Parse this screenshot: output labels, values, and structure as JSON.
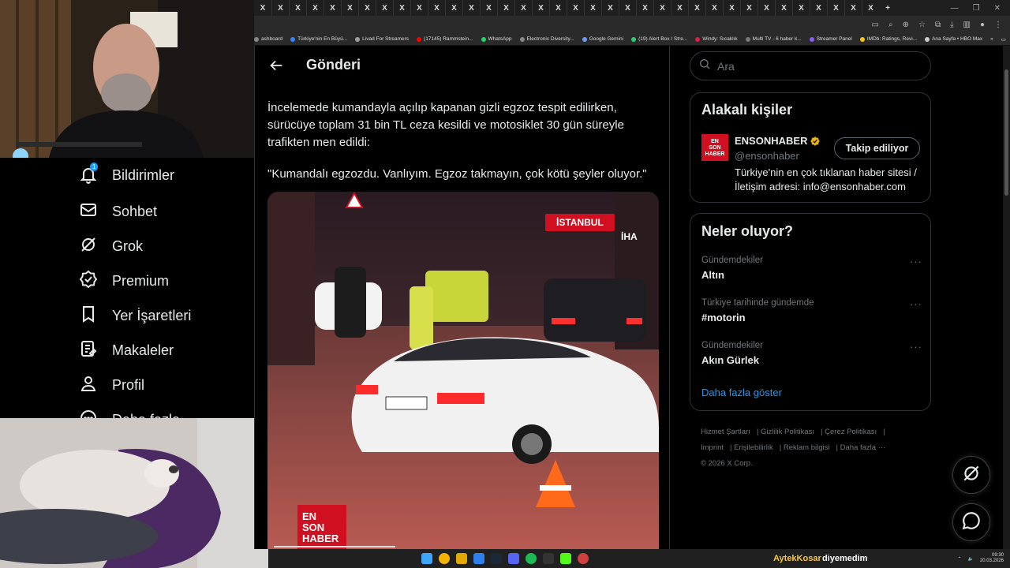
{
  "browser": {
    "tab_glyph": "X",
    "new_tab": "+",
    "bookmarks": [
      {
        "label": "ashboard",
        "color": "#888888"
      },
      {
        "label": "Türkiye'nin En Büyü...",
        "color": "#3b82f6"
      },
      {
        "label": "Livad For Streamers",
        "color": "#a0a0a0"
      },
      {
        "label": "(17145) Rammstein...",
        "color": "#ff0000"
      },
      {
        "label": "WhatsApp",
        "color": "#25d366"
      },
      {
        "label": "Electronic Diversity...",
        "color": "#888888"
      },
      {
        "label": "Google Gemini",
        "color": "#6a9cf7"
      },
      {
        "label": "(19) Alert Box / Stre...",
        "color": "#2ecc71"
      },
      {
        "label": "Windy: Sıcaklık",
        "color": "#d91e48"
      },
      {
        "label": "Multi TV - 6 haber k...",
        "color": "#777777"
      },
      {
        "label": "Streamer Panel",
        "color": "#8b5cf6"
      },
      {
        "label": "IMDb: Ratings, Revi...",
        "color": "#f5c518"
      },
      {
        "label": "Ana Sayfa • HBO Max",
        "color": "#cccccc"
      }
    ],
    "bookmarks_more": "»",
    "all_bookmarks": "Tüm Yer İşaretleri"
  },
  "nav": {
    "notification_badge": "1",
    "items": [
      {
        "label": "Bildirimler",
        "icon": "bell-icon"
      },
      {
        "label": "Sohbet",
        "icon": "mail-icon"
      },
      {
        "label": "Grok",
        "icon": "grok-icon"
      },
      {
        "label": "Premium",
        "icon": "verified-icon"
      },
      {
        "label": "Yer İşaretleri",
        "icon": "bookmark-icon"
      },
      {
        "label": "Makaleler",
        "icon": "article-icon"
      },
      {
        "label": "Profil",
        "icon": "profile-icon"
      },
      {
        "label": "Daha fazla",
        "icon": "more-icon"
      }
    ]
  },
  "post": {
    "header_title": "Gönderi",
    "text": "İncelemede kumandayla açılıp kapanan gizli egzoz tespit edilirken, sürücüye toplam 31 bin TL ceza kesildi ve motosiklet 30 gün süreyle trafikten men edildi:",
    "quote": "\"Kumandalı egzozdu. Vanlıyım. Egzoz takmayın, çok kötü şeyler oluyor.\"",
    "media_label": "İSTANBUL",
    "media_agency": "İHA",
    "media_logo": [
      "EN",
      "SON",
      "HABER"
    ],
    "media_progress": 0.32
  },
  "sidebar": {
    "search_placeholder": "Ara",
    "related": {
      "title": "Alakalı kişiler",
      "name": "ENSONHABER",
      "handle": "@ensonhaber",
      "follow_label": "Takip ediliyor",
      "bio": "Türkiye'nin en çok tıklanan haber sitesi / İletişim adresi: info@ensonhaber.com",
      "avatar_lines": [
        "EN",
        "SON",
        "HABER"
      ],
      "verified_color": "#e8b213"
    },
    "trending": {
      "title": "Neler oluyor?",
      "items": [
        {
          "context": "Gündemdekiler",
          "name": "Altın"
        },
        {
          "context": "Türkiye tarihinde gündemde",
          "name": "#motorin"
        },
        {
          "context": "Gündemdekiler",
          "name": "Akın Gürlek"
        }
      ],
      "more_glyph": "···",
      "show_more": "Daha fazla göster"
    },
    "footer": {
      "links": [
        "Hizmet Şartları",
        "Gizlilik Politikası",
        "Çerez Politikası",
        "Imprint",
        "Erişilebilirlik",
        "Reklam bilgisi",
        "Daha fazla ···"
      ],
      "copyright": "© 2026 X Corp."
    }
  },
  "taskbar": {
    "chat_user": "AytekKosar",
    "chat_message": "diyemedim",
    "time": "09:30",
    "date": "20.03.2026"
  },
  "colors": {
    "accent": "#1d9bf0",
    "brand_red": "#d01020"
  }
}
